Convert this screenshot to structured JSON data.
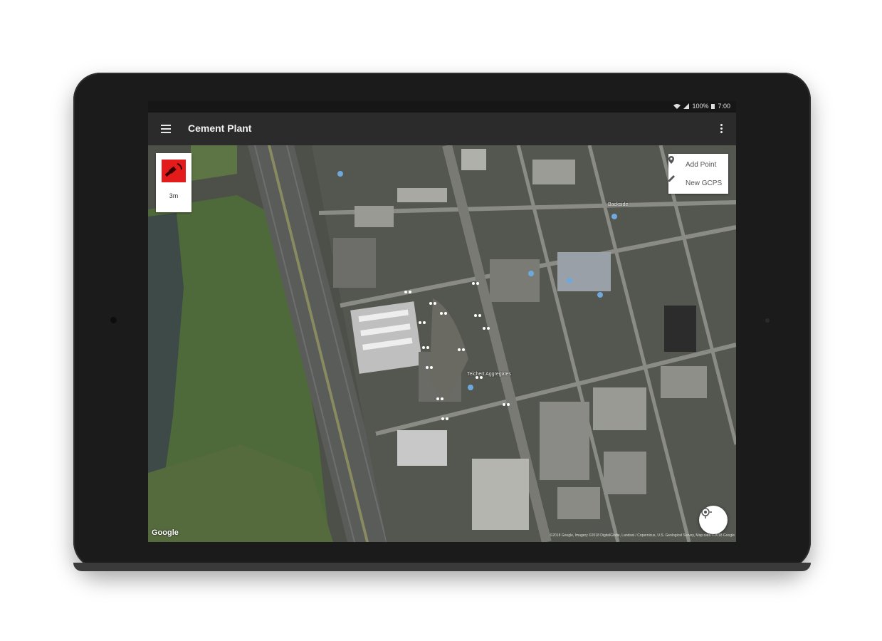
{
  "status_bar": {
    "battery": "100%",
    "time": "7:00"
  },
  "app_bar": {
    "title": "Cement Plant"
  },
  "gps_widget": {
    "accuracy": "3m"
  },
  "actions": {
    "add_point": "Add Point",
    "new_gcps": "New GCPS"
  },
  "map": {
    "logo": "Google",
    "attribution": "©2018 Google, Imagery ©2018 DigitalGlobe, Landsat / Copernicus, U.S. Geological Survey, Map data ©2018 Google",
    "poi_labels": [
      "Backside",
      "Teichert Aggregates"
    ]
  },
  "colors": {
    "gps_red": "#e31b1b",
    "app_bar": "#2b2b2b",
    "status_bar": "#161616"
  }
}
